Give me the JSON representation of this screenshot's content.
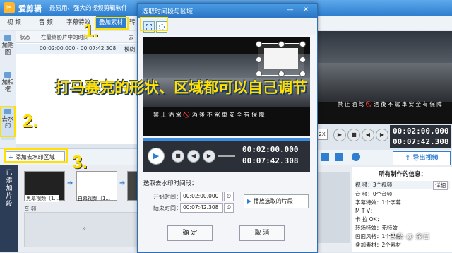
{
  "app": {
    "name": "爱剪辑",
    "slogan": "最易用、强大的视频剪辑软件",
    "logo_icon": "scissors-logo-icon"
  },
  "menu": {
    "tabs": [
      {
        "label": "视  频"
      },
      {
        "label": "音  频"
      },
      {
        "label": "字幕特效"
      },
      {
        "label": "叠加素材"
      },
      {
        "label": "转"
      }
    ]
  },
  "sidebar": {
    "items": [
      {
        "label": "加贴图"
      },
      {
        "label": "加相框"
      },
      {
        "label": "去水印"
      }
    ]
  },
  "list": {
    "headers": [
      "状态",
      "在最终影片中的时间",
      "去"
    ],
    "row": {
      "time": "00:02:00.000 - 00:07:42.308",
      "type": "模糊"
    }
  },
  "add_button": "添加去水印区域",
  "timeline": {
    "side_label": "已添加片段",
    "clips": [
      {
        "label": "黑幕视频（1..."
      },
      {
        "label": "白幕视频（1..."
      }
    ],
    "audio_label": "音 频"
  },
  "right": {
    "time_current": "00:02:00.000",
    "time_total": "00:07:42.308",
    "speed_label": "2X",
    "export_label": "导出视频",
    "info_title": "所有制作的信息：",
    "info_rows": [
      {
        "key": "视    频：",
        "val": "3个视频",
        "link": "详细"
      },
      {
        "key": "音    频：",
        "val": "0个音频"
      },
      {
        "key": "字幕特效：",
        "val": "1个字幕"
      },
      {
        "key": "M  T  V：",
        "val": ""
      },
      {
        "key": "卡 拉 OK：",
        "val": ""
      },
      {
        "key": "转场特效：",
        "val": "无特效"
      },
      {
        "key": "画面风格：",
        "val": "1个风格"
      },
      {
        "key": "叠加素材：",
        "val": "2个素材"
      }
    ],
    "subtitle_strip": "禁 止 洒 驾 🚫 洒 後 不 駕 車  安 全 有 保 障"
  },
  "dialog": {
    "title": "选取时间段与区域",
    "video_subtitle": "禁 止 洒 駕 🚫 酒 後 不 駕 車  安 全 有 保 障",
    "time_current": "00:02:00.000",
    "time_total": "00:07:42.308",
    "section_label": "选取去水印时间段：",
    "start_label": "开始时间：",
    "start_value": "00:02:00.000",
    "end_label": "结束时间：",
    "end_value": "00:07:42.308",
    "play_selected": "播放选取的片段",
    "ok": "确  定",
    "cancel": "取  消"
  },
  "annotations": {
    "n1": "1.",
    "n2": "2.",
    "n3": "3.",
    "big_text": "打马赛克的形状、区域都可以自己调节",
    "highlight_color": "#ffe000"
  },
  "watermark": "头条 @ 金石"
}
